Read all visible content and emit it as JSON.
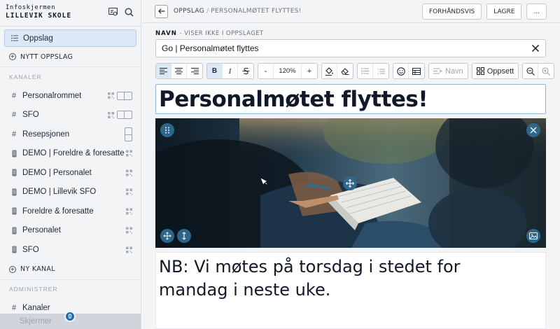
{
  "brand": {
    "line1": "Infoskjermen",
    "line2": "LILLEVIK SKOLE"
  },
  "sidebar": {
    "active_item": "Oppslag",
    "new_post": "NYTT OPPSLAG",
    "channels_heading": "KANALER",
    "channels": [
      {
        "label": "Personalrommet",
        "icon": "hash-icon",
        "control": "toggle"
      },
      {
        "label": "SFO",
        "icon": "hash-icon",
        "control": "toggle"
      },
      {
        "label": "Resepsjonen",
        "icon": "hash-icon",
        "control": "vtoggle"
      },
      {
        "label": "DEMO | Foreldre & foresatte",
        "icon": "phone-icon",
        "control": "qr"
      },
      {
        "label": "DEMO | Personalet",
        "icon": "phone-icon",
        "control": "qr"
      },
      {
        "label": "DEMO | Lillevik SFO",
        "icon": "phone-icon",
        "control": "qr"
      },
      {
        "label": "Foreldre & foresatte",
        "icon": "phone-icon",
        "control": "qr"
      },
      {
        "label": "Personalet",
        "icon": "phone-icon",
        "control": "qr"
      },
      {
        "label": "SFO",
        "icon": "phone-icon",
        "control": "qr"
      }
    ],
    "new_channel": "NY KANAL",
    "admin_heading": "ADMINISTRER",
    "admin_items": [
      {
        "label": "Kanaler",
        "icon": "hash-icon"
      }
    ],
    "partial_item": "Skjermer",
    "badge": "0"
  },
  "topbar": {
    "crumb_root": "OPPSLAG",
    "crumb_sep": "/",
    "crumb_current": "PERSONALMØTET FLYTTES!",
    "preview": "FORHÅNDSVIS",
    "save": "LAGRE",
    "more": "..."
  },
  "editor": {
    "name_label": "NAVN",
    "name_hint": "- VISER IKKE I OPPSLAGET",
    "name_value": "Go | Personalmøtet flyttes",
    "toolbar": {
      "bold": "B",
      "italic": "I",
      "minus": "-",
      "zoom": "120%",
      "plus": "+",
      "name_btn": "Navn",
      "layout_btn": "Oppsett"
    },
    "title": "Personalmøtet flyttes!",
    "body_lines": [
      "NB: Vi møtes på torsdag i stedet for",
      "mandag i neste uke."
    ]
  },
  "colors": {
    "accent": "#1f6fb5",
    "active_bg": "#dbe9f7",
    "overlay": "#2f6a8e"
  }
}
